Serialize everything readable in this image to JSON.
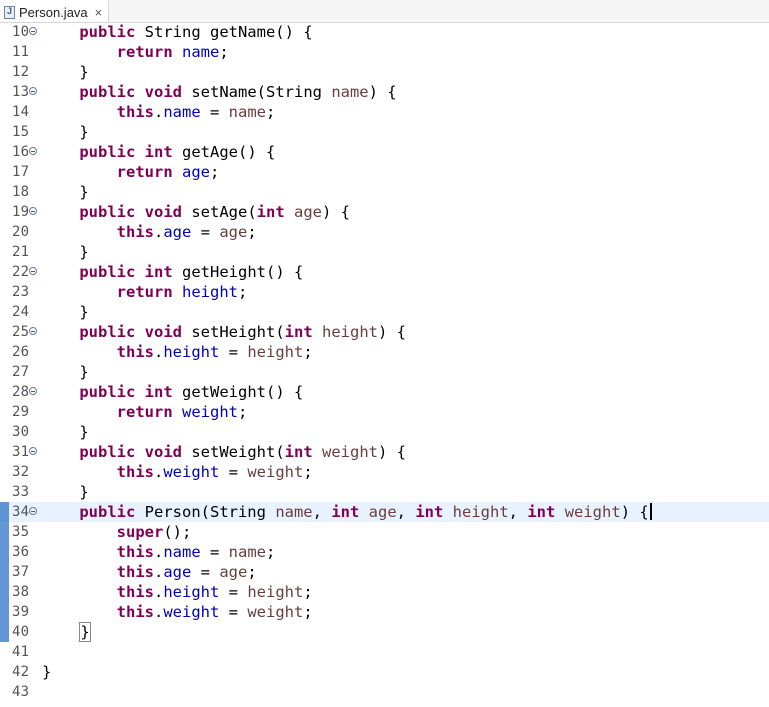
{
  "tab": {
    "title": "Person.java",
    "close_glyph": "×",
    "icon": "java-file-icon"
  },
  "colors": {
    "keyword": "#7f0055",
    "field": "#0000c0",
    "parameter": "#6a3e3e",
    "current_line": "#e8f2fe",
    "change_bar": "#2f74c5"
  },
  "lines": [
    {
      "n": "10",
      "fold": true,
      "code": "    public String getName() {"
    },
    {
      "n": "11",
      "fold": false,
      "code": "        return name;"
    },
    {
      "n": "12",
      "fold": false,
      "code": "    }"
    },
    {
      "n": "13",
      "fold": true,
      "code": "    public void setName(String name) {"
    },
    {
      "n": "14",
      "fold": false,
      "code": "        this.name = name;"
    },
    {
      "n": "15",
      "fold": false,
      "code": "    }"
    },
    {
      "n": "16",
      "fold": true,
      "code": "    public int getAge() {"
    },
    {
      "n": "17",
      "fold": false,
      "code": "        return age;"
    },
    {
      "n": "18",
      "fold": false,
      "code": "    }"
    },
    {
      "n": "19",
      "fold": true,
      "code": "    public void setAge(int age) {"
    },
    {
      "n": "20",
      "fold": false,
      "code": "        this.age = age;"
    },
    {
      "n": "21",
      "fold": false,
      "code": "    }"
    },
    {
      "n": "22",
      "fold": true,
      "code": "    public int getHeight() {"
    },
    {
      "n": "23",
      "fold": false,
      "code": "        return height;"
    },
    {
      "n": "24",
      "fold": false,
      "code": "    }"
    },
    {
      "n": "25",
      "fold": true,
      "code": "    public void setHeight(int height) {"
    },
    {
      "n": "26",
      "fold": false,
      "code": "        this.height = height;"
    },
    {
      "n": "27",
      "fold": false,
      "code": "    }"
    },
    {
      "n": "28",
      "fold": true,
      "code": "    public int getWeight() {"
    },
    {
      "n": "29",
      "fold": false,
      "code": "        return weight;"
    },
    {
      "n": "30",
      "fold": false,
      "code": "    }"
    },
    {
      "n": "31",
      "fold": true,
      "code": "    public void setWeight(int weight) {"
    },
    {
      "n": "32",
      "fold": false,
      "code": "        this.weight = weight;"
    },
    {
      "n": "33",
      "fold": false,
      "code": "    }"
    },
    {
      "n": "34",
      "fold": true,
      "changed": true,
      "current": true,
      "caret": true,
      "code": "    public Person(String name, int age, int height, int weight) {"
    },
    {
      "n": "35",
      "fold": false,
      "changed": true,
      "code": "        super();"
    },
    {
      "n": "36",
      "fold": false,
      "changed": true,
      "code": "        this.name = name;"
    },
    {
      "n": "37",
      "fold": false,
      "changed": true,
      "code": "        this.age = age;"
    },
    {
      "n": "38",
      "fold": false,
      "changed": true,
      "code": "        this.height = height;"
    },
    {
      "n": "39",
      "fold": false,
      "changed": true,
      "code": "        this.weight = weight;"
    },
    {
      "n": "40",
      "fold": false,
      "changed": true,
      "matched_bracket": true,
      "code": "    }"
    },
    {
      "n": "41",
      "fold": false,
      "code": ""
    },
    {
      "n": "42",
      "fold": false,
      "code": "}"
    },
    {
      "n": "43",
      "fold": false,
      "code": ""
    }
  ]
}
